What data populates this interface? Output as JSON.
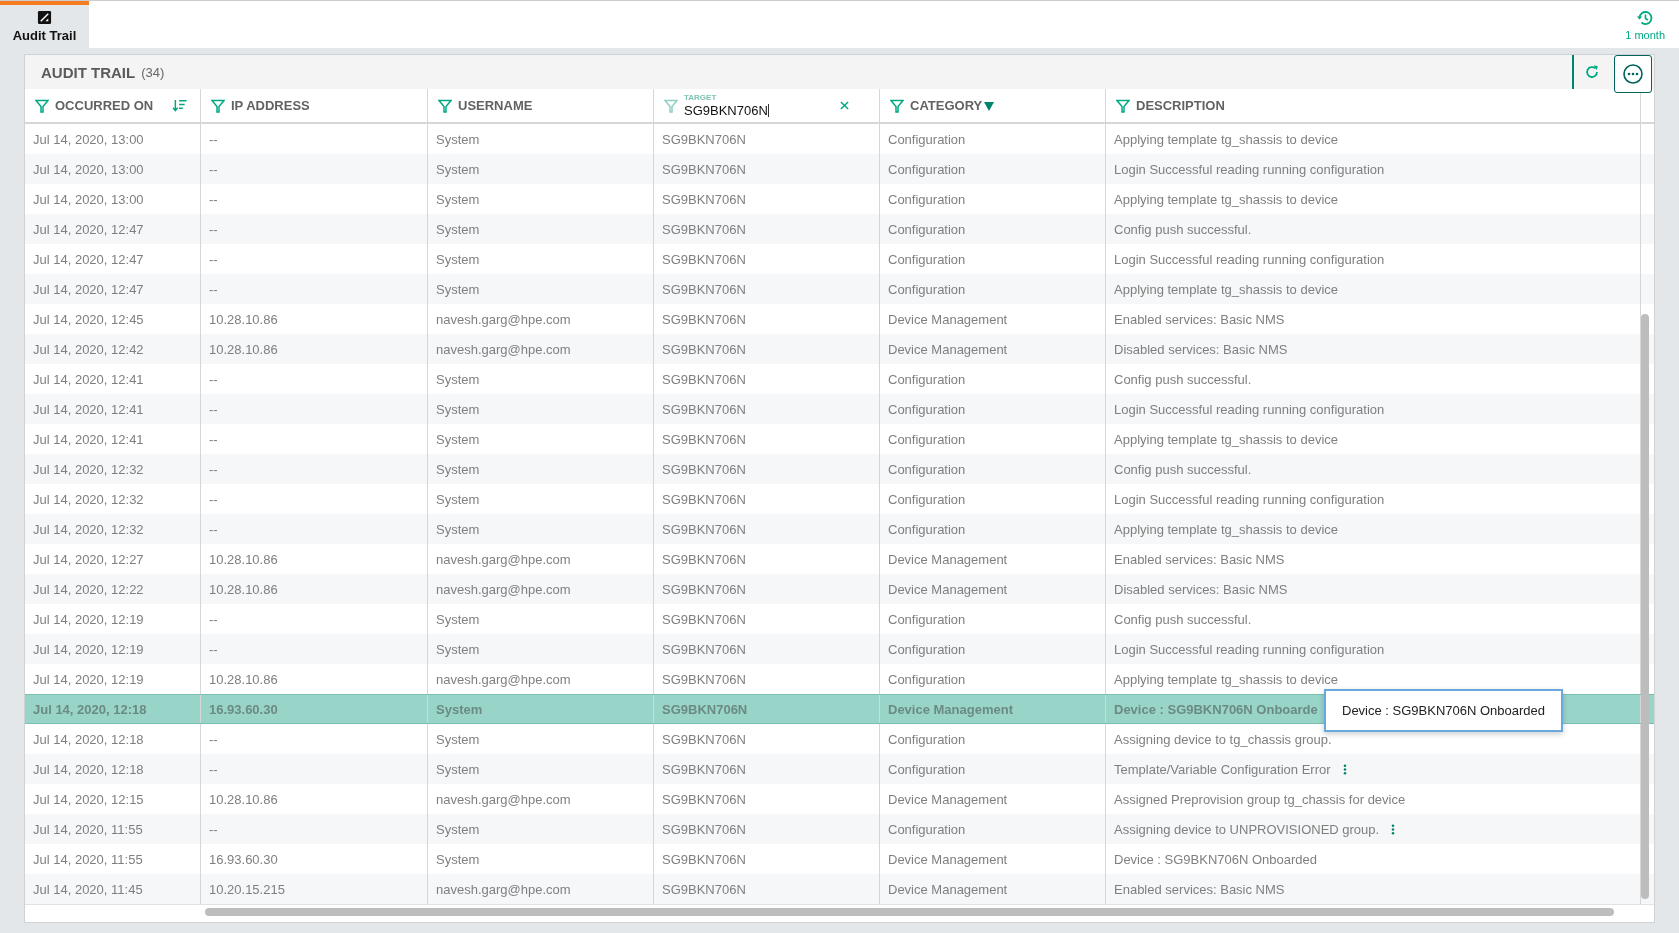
{
  "top_tab": {
    "label": "Audit Trail",
    "selected": true
  },
  "time_range": {
    "label": "1 month"
  },
  "panel": {
    "title": "AUDIT TRAIL",
    "count": "(34)"
  },
  "columns": [
    {
      "label": "OCCURRED ON",
      "kind": "sort-lines"
    },
    {
      "label": "IP ADDRESS",
      "kind": "plain"
    },
    {
      "label": "USERNAME",
      "kind": "plain"
    },
    {
      "label": "TARGET",
      "kind": "filter-field",
      "value": "SG9BKN706N"
    },
    {
      "label": "CATEGORY",
      "kind": "sorted"
    },
    {
      "label": "DESCRIPTION",
      "kind": "plain"
    }
  ],
  "rows": [
    {
      "cells": [
        "Jul 14, 2020, 13:00",
        "--",
        "System",
        "SG9BKN706N",
        "Configuration",
        "Applying template tg_shassis to device"
      ],
      "selected": false,
      "more_menu": false
    },
    {
      "cells": [
        "Jul 14, 2020, 13:00",
        "--",
        "System",
        "SG9BKN706N",
        "Configuration",
        "Login Successful reading running configuration"
      ],
      "selected": false,
      "more_menu": false
    },
    {
      "cells": [
        "Jul 14, 2020, 13:00",
        "--",
        "System",
        "SG9BKN706N",
        "Configuration",
        "Applying template tg_shassis to device"
      ],
      "selected": false,
      "more_menu": false
    },
    {
      "cells": [
        "Jul 14, 2020, 12:47",
        "--",
        "System",
        "SG9BKN706N",
        "Configuration",
        "Config push successful."
      ],
      "selected": false,
      "more_menu": false
    },
    {
      "cells": [
        "Jul 14, 2020, 12:47",
        "--",
        "System",
        "SG9BKN706N",
        "Configuration",
        "Login Successful reading running configuration"
      ],
      "selected": false,
      "more_menu": false
    },
    {
      "cells": [
        "Jul 14, 2020, 12:47",
        "--",
        "System",
        "SG9BKN706N",
        "Configuration",
        "Applying template tg_shassis to device"
      ],
      "selected": false,
      "more_menu": false
    },
    {
      "cells": [
        "Jul 14, 2020, 12:45",
        "10.28.10.86",
        "navesh.garg@hpe.com",
        "SG9BKN706N",
        "Device Management",
        "Enabled services: Basic NMS"
      ],
      "selected": false,
      "more_menu": false
    },
    {
      "cells": [
        "Jul 14, 2020, 12:42",
        "10.28.10.86",
        "navesh.garg@hpe.com",
        "SG9BKN706N",
        "Device Management",
        "Disabled services: Basic NMS"
      ],
      "selected": false,
      "more_menu": false
    },
    {
      "cells": [
        "Jul 14, 2020, 12:41",
        "--",
        "System",
        "SG9BKN706N",
        "Configuration",
        "Config push successful."
      ],
      "selected": false,
      "more_menu": false
    },
    {
      "cells": [
        "Jul 14, 2020, 12:41",
        "--",
        "System",
        "SG9BKN706N",
        "Configuration",
        "Login Successful reading running configuration"
      ],
      "selected": false,
      "more_menu": false
    },
    {
      "cells": [
        "Jul 14, 2020, 12:41",
        "--",
        "System",
        "SG9BKN706N",
        "Configuration",
        "Applying template tg_shassis to device"
      ],
      "selected": false,
      "more_menu": false
    },
    {
      "cells": [
        "Jul 14, 2020, 12:32",
        "--",
        "System",
        "SG9BKN706N",
        "Configuration",
        "Config push successful."
      ],
      "selected": false,
      "more_menu": false
    },
    {
      "cells": [
        "Jul 14, 2020, 12:32",
        "--",
        "System",
        "SG9BKN706N",
        "Configuration",
        "Login Successful reading running configuration"
      ],
      "selected": false,
      "more_menu": false
    },
    {
      "cells": [
        "Jul 14, 2020, 12:32",
        "--",
        "System",
        "SG9BKN706N",
        "Configuration",
        "Applying template tg_shassis to device"
      ],
      "selected": false,
      "more_menu": false
    },
    {
      "cells": [
        "Jul 14, 2020, 12:27",
        "10.28.10.86",
        "navesh.garg@hpe.com",
        "SG9BKN706N",
        "Device Management",
        "Enabled services: Basic NMS"
      ],
      "selected": false,
      "more_menu": false
    },
    {
      "cells": [
        "Jul 14, 2020, 12:22",
        "10.28.10.86",
        "navesh.garg@hpe.com",
        "SG9BKN706N",
        "Device Management",
        "Disabled services: Basic NMS"
      ],
      "selected": false,
      "more_menu": false
    },
    {
      "cells": [
        "Jul 14, 2020, 12:19",
        "--",
        "System",
        "SG9BKN706N",
        "Configuration",
        "Config push successful."
      ],
      "selected": false,
      "more_menu": false
    },
    {
      "cells": [
        "Jul 14, 2020, 12:19",
        "--",
        "System",
        "SG9BKN706N",
        "Configuration",
        "Login Successful reading running configuration"
      ],
      "selected": false,
      "more_menu": false
    },
    {
      "cells": [
        "Jul 14, 2020, 12:19",
        "10.28.10.86",
        "navesh.garg@hpe.com",
        "SG9BKN706N",
        "Configuration",
        "Applying template tg_shassis to device"
      ],
      "selected": false,
      "more_menu": false
    },
    {
      "cells": [
        "Jul 14, 2020, 12:18",
        "16.93.60.30",
        "System",
        "SG9BKN706N",
        "Device Management",
        "Device : SG9BKN706N Onboarde"
      ],
      "selected": true,
      "more_menu": false
    },
    {
      "cells": [
        "Jul 14, 2020, 12:18",
        "--",
        "System",
        "SG9BKN706N",
        "Configuration",
        "Assigning device to tg_chassis group."
      ],
      "selected": false,
      "more_menu": false
    },
    {
      "cells": [
        "Jul 14, 2020, 12:18",
        "--",
        "System",
        "SG9BKN706N",
        "Configuration",
        "Template/Variable Configuration Error"
      ],
      "selected": false,
      "more_menu": true
    },
    {
      "cells": [
        "Jul 14, 2020, 12:15",
        "10.28.10.86",
        "navesh.garg@hpe.com",
        "SG9BKN706N",
        "Device Management",
        "Assigned Preprovision group tg_chassis for device"
      ],
      "selected": false,
      "more_menu": false
    },
    {
      "cells": [
        "Jul 14, 2020, 11:55",
        "--",
        "System",
        "SG9BKN706N",
        "Configuration",
        "Assigning device to UNPROVISIONED group."
      ],
      "selected": false,
      "more_menu": true
    },
    {
      "cells": [
        "Jul 14, 2020, 11:55",
        "16.93.60.30",
        "System",
        "SG9BKN706N",
        "Device Management",
        "Device : SG9BKN706N Onboarded"
      ],
      "selected": false,
      "more_menu": false
    },
    {
      "cells": [
        "Jul 14, 2020, 11:45",
        "10.20.15.215",
        "navesh.garg@hpe.com",
        "SG9BKN706N",
        "Device Management",
        "Enabled services: Basic NMS"
      ],
      "selected": false,
      "more_menu": false
    }
  ],
  "tooltip": {
    "text": "Device : SG9BKN706N Onboarded"
  }
}
